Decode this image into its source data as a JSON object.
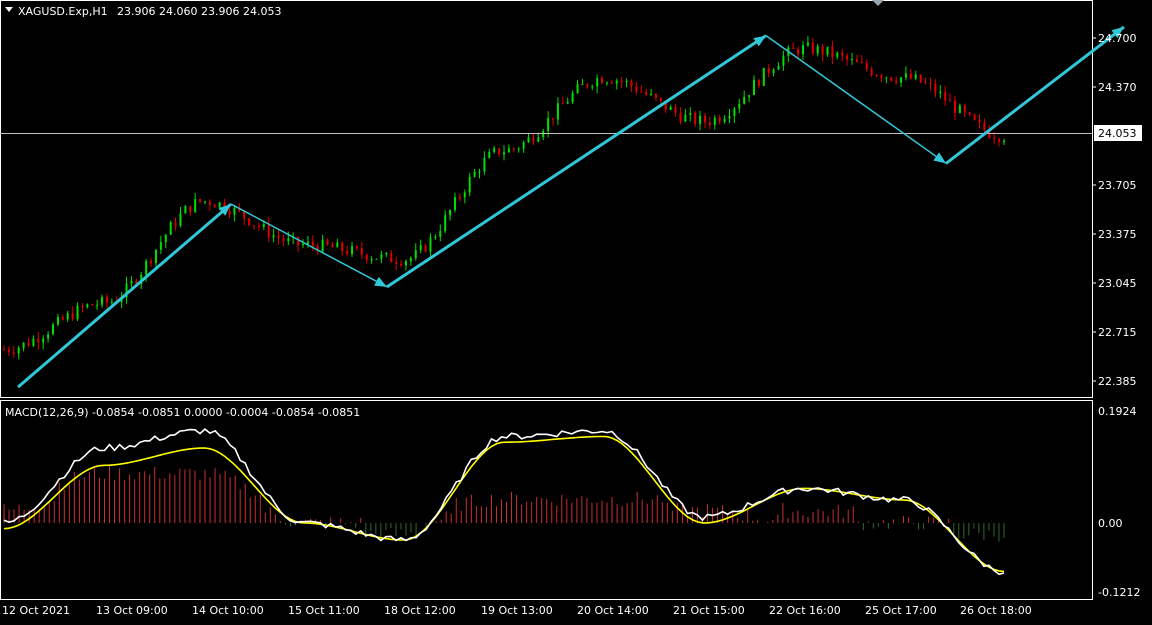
{
  "main_panel": {
    "symbol": "XAGUSD.Exp,H1",
    "ohlc": "23.906 24.060 23.906 24.053",
    "price_ticks": [
      "24.700",
      "24.370",
      "24.053",
      "23.705",
      "23.375",
      "23.045",
      "22.715",
      "22.385"
    ],
    "current_price": "24.053"
  },
  "macd_panel": {
    "header": "MACD(12,26,9) -0.0854 -0.0851 0.0000 -0.0004 -0.0854 -0.0851",
    "ticks": [
      "0.1924",
      "0.00",
      "-0.1212"
    ]
  },
  "time_axis": {
    "labels": [
      "12 Oct 2021",
      "13 Oct 09:00",
      "14 Oct 10:00",
      "15 Oct 11:00",
      "18 Oct 12:00",
      "19 Oct 13:00",
      "20 Oct 14:00",
      "21 Oct 15:00",
      "22 Oct 16:00",
      "25 Oct 17:00",
      "26 Oct 18:00"
    ]
  },
  "colors": {
    "bull": "#00e000",
    "bear": "#e00000",
    "arrow": "#30c8d8",
    "macd_line": "#ffffff",
    "signal_line": "#ffff00",
    "hist_pos": "#c83030",
    "hist_neg": "#2f6a2f",
    "axis": "#ffffff",
    "grid_line": "#c0c0c0"
  },
  "chart_data": {
    "type": "line",
    "title": "XAGUSD.Exp,H1",
    "x": [
      "12 Oct 2021",
      "13 Oct 09:00",
      "14 Oct 10:00",
      "15 Oct 11:00",
      "18 Oct 12:00",
      "19 Oct 13:00",
      "20 Oct 14:00",
      "21 Oct 15:00",
      "22 Oct 16:00",
      "25 Oct 17:00",
      "26 Oct 18:00"
    ],
    "price_close_approx": [
      22.58,
      22.9,
      23.6,
      23.3,
      23.2,
      23.95,
      24.45,
      24.15,
      24.65,
      24.45,
      24.05
    ],
    "zigzag_pivots": [
      {
        "x": "12 Oct 2021",
        "y": 22.32
      },
      {
        "x": "14 Oct 10:00",
        "y": 23.58
      },
      {
        "x": "18 Oct 12:00",
        "y": 23.01
      },
      {
        "x": "21 Oct 15:00",
        "y": 24.74
      },
      {
        "x": "25 Oct 17:00",
        "y": 23.86
      },
      {
        "x": "26 Oct 18:00",
        "y": 24.8
      }
    ],
    "ylim": [
      22.3,
      24.82
    ],
    "macd": {
      "ylim": [
        -0.1212,
        0.1924
      ],
      "macd_line_approx": [
        0.0,
        0.13,
        0.16,
        0.0,
        -0.03,
        0.15,
        0.16,
        0.01,
        0.06,
        0.04,
        -0.085
      ],
      "signal_line_approx": [
        -0.01,
        0.1,
        0.13,
        0.0,
        -0.03,
        0.14,
        0.15,
        0.0,
        0.06,
        0.04,
        -0.085
      ]
    }
  }
}
